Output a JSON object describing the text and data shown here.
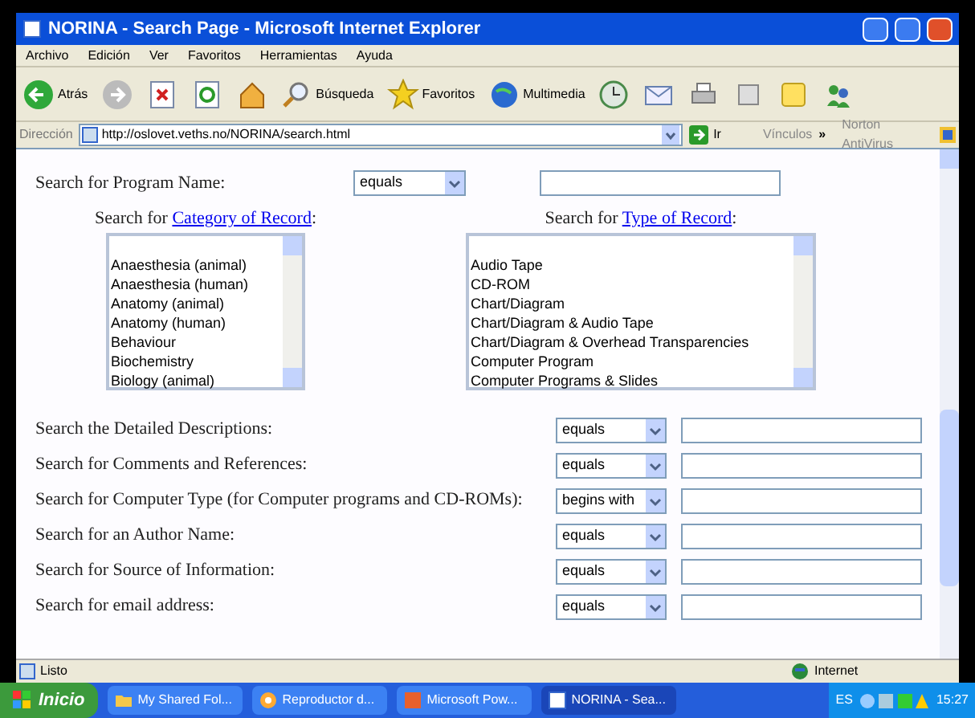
{
  "window": {
    "title": "NORINA - Search Page - Microsoft Internet Explorer"
  },
  "menu": [
    "Archivo",
    "Edición",
    "Ver",
    "Favoritos",
    "Herramientas",
    "Ayuda"
  ],
  "toolbar": [
    {
      "kind": "back",
      "label": "Atrás"
    },
    {
      "kind": "forward"
    },
    {
      "kind": "stop"
    },
    {
      "kind": "refresh"
    },
    {
      "kind": "home"
    },
    {
      "kind": "search",
      "label": "Búsqueda"
    },
    {
      "kind": "favorites",
      "label": "Favoritos"
    },
    {
      "kind": "media",
      "label": "Multimedia"
    },
    {
      "kind": "history"
    },
    {
      "kind": "mail"
    },
    {
      "kind": "print"
    },
    {
      "kind": "edit"
    },
    {
      "kind": "note"
    },
    {
      "kind": "messenger"
    }
  ],
  "address": {
    "label": "Dirección",
    "url": "http://oslovet.veths.no/NORINA/search.html",
    "go": "Ir",
    "links": "Vínculos",
    "chevron": "»",
    "norton": "Norton AntiVirus"
  },
  "program_name": {
    "label": "Search for Program Name:",
    "operator": "equals"
  },
  "lists": [
    {
      "prefix": "Search for",
      "link": "Category of Record",
      "suffix": ":",
      "items": [
        "Anaesthesia (animal)",
        "Anaesthesia (human)",
        "Anatomy (animal)",
        "Anatomy (human)",
        "Behaviour",
        "Biochemistry",
        "Biology (animal)"
      ]
    },
    {
      "prefix": "Search for",
      "link": "Type of Record",
      "suffix": ":",
      "items": [
        "Audio Tape",
        "CD-ROM",
        "Chart/Diagram",
        "Chart/Diagram & Audio Tape",
        "Chart/Diagram & Overhead Transparencies",
        "Computer Program",
        "Computer Programs & Slides"
      ]
    }
  ],
  "fields": [
    {
      "label": "Search the Detailed Descriptions:",
      "operator": "equals"
    },
    {
      "label": "Search for Comments and References:",
      "operator": "equals"
    },
    {
      "label": "Search for Computer Type (for Computer programs and CD-ROMs):",
      "operator": "begins with"
    },
    {
      "label": "Search for an Author Name:",
      "operator": "equals"
    },
    {
      "label": "Search for Source of Information:",
      "operator": "equals"
    },
    {
      "label": "Search for email address:",
      "operator": "equals"
    }
  ],
  "status_bar": {
    "text": "Listo",
    "zone": "Internet"
  },
  "taskbar": {
    "start": "Inicio",
    "tasks": [
      {
        "label": "My Shared Fol...",
        "kind": "folder",
        "selected": false
      },
      {
        "label": "Reproductor d...",
        "kind": "media",
        "selected": false
      },
      {
        "label": "Microsoft Pow...",
        "kind": "slides",
        "selected": false
      },
      {
        "label": "NORINA - Sea...",
        "kind": "browser",
        "selected": true
      }
    ],
    "language": "ES",
    "clock": "15:27"
  }
}
